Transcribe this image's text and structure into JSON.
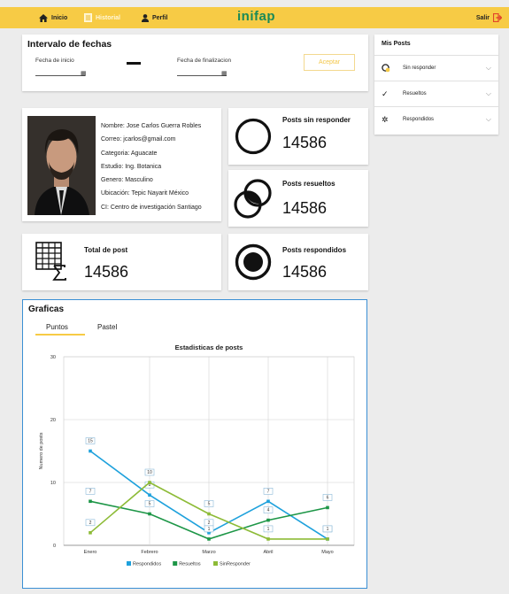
{
  "nav": {
    "inicio": "Inicio",
    "historial": "Historial",
    "perfil": "Perfil",
    "brand": "inifap",
    "salir": "Salir",
    "bar_color": "#f7cb45",
    "brand_color": "#1a8a57"
  },
  "date_range": {
    "title": "Intervalo de fechas",
    "start_label": "Fecha de inicio",
    "end_label": "Fecha de finalizacion",
    "start_value": "",
    "end_value": "",
    "accept": "Aceptar"
  },
  "my_posts": {
    "title": "Mis Posts",
    "items": [
      {
        "label": "Sin responder",
        "icon": "unanswered-icon"
      },
      {
        "label": "Resueltos",
        "icon": "check-icon"
      },
      {
        "label": "Respondidos",
        "icon": "spinner-icon"
      }
    ]
  },
  "profile": {
    "nombre": "Nombre: Jose Carlos Guerra Robles",
    "correo": "Correo: jcarlos@gmail.com",
    "categoria": "Categoria: Aguacate",
    "estudio": "Estudio: Ing. Botanica",
    "genero": "Genero: Masculino",
    "ubicacion": "Ubicación: Tepic Nayarit México",
    "ci": "CI: Centro de investigación Santiago"
  },
  "stats": {
    "sin_responder": {
      "title": "Posts sin responder",
      "value": "14586"
    },
    "resueltos": {
      "title": "Posts resueltos",
      "value": "14586"
    },
    "total": {
      "title": "Total de post",
      "value": "14586"
    },
    "respondidos": {
      "title": "Posts respondidos",
      "value": "14586"
    }
  },
  "charts": {
    "title": "Graficas",
    "tabs": [
      "Puntos",
      "Pastel"
    ],
    "active_tab": "Puntos"
  },
  "chart_data": {
    "type": "line",
    "title": "Estadisticas de posts",
    "xlabel": "",
    "ylabel": "Numero de posts",
    "categories": [
      "Enero",
      "Febrero",
      "Marzo",
      "Abril",
      "Mayo"
    ],
    "ylim": [
      0,
      30
    ],
    "yticks": [
      0,
      10,
      20,
      30
    ],
    "grid": true,
    "legend_position": "bottom",
    "series": [
      {
        "name": "Respondidos",
        "color": "#1ea1dc",
        "values": [
          15,
          8,
          2,
          7,
          1
        ]
      },
      {
        "name": "Resueltos",
        "color": "#1d9647",
        "values": [
          7,
          5,
          1,
          4,
          6
        ]
      },
      {
        "name": "SinResponder",
        "color": "#8dbb37",
        "values": [
          2,
          10,
          5,
          1,
          1
        ]
      }
    ]
  }
}
